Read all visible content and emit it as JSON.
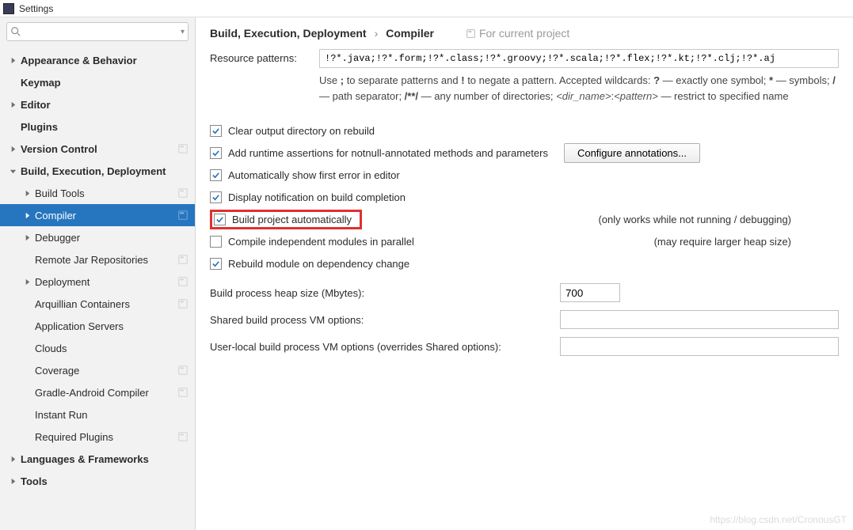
{
  "window": {
    "title": "Settings"
  },
  "search": {
    "placeholder": ""
  },
  "tree": [
    {
      "label": "Appearance & Behavior",
      "level": 0,
      "bold": true,
      "arrow": "right",
      "proj": false
    },
    {
      "label": "Keymap",
      "level": 0,
      "bold": true,
      "arrow": "none",
      "proj": false
    },
    {
      "label": "Editor",
      "level": 0,
      "bold": true,
      "arrow": "right",
      "proj": false
    },
    {
      "label": "Plugins",
      "level": 0,
      "bold": true,
      "arrow": "none",
      "proj": false
    },
    {
      "label": "Version Control",
      "level": 0,
      "bold": true,
      "arrow": "right",
      "proj": true
    },
    {
      "label": "Build, Execution, Deployment",
      "level": 0,
      "bold": true,
      "arrow": "down",
      "proj": false
    },
    {
      "label": "Build Tools",
      "level": 1,
      "bold": false,
      "arrow": "right",
      "proj": true
    },
    {
      "label": "Compiler",
      "level": 1,
      "bold": false,
      "arrow": "right",
      "proj": true,
      "selected": true
    },
    {
      "label": "Debugger",
      "level": 1,
      "bold": false,
      "arrow": "right",
      "proj": false
    },
    {
      "label": "Remote Jar Repositories",
      "level": 1,
      "bold": false,
      "arrow": "none",
      "proj": true
    },
    {
      "label": "Deployment",
      "level": 1,
      "bold": false,
      "arrow": "right",
      "proj": true
    },
    {
      "label": "Arquillian Containers",
      "level": 1,
      "bold": false,
      "arrow": "none",
      "proj": true
    },
    {
      "label": "Application Servers",
      "level": 1,
      "bold": false,
      "arrow": "none",
      "proj": false
    },
    {
      "label": "Clouds",
      "level": 1,
      "bold": false,
      "arrow": "none",
      "proj": false
    },
    {
      "label": "Coverage",
      "level": 1,
      "bold": false,
      "arrow": "none",
      "proj": true
    },
    {
      "label": "Gradle-Android Compiler",
      "level": 1,
      "bold": false,
      "arrow": "none",
      "proj": true
    },
    {
      "label": "Instant Run",
      "level": 1,
      "bold": false,
      "arrow": "none",
      "proj": false
    },
    {
      "label": "Required Plugins",
      "level": 1,
      "bold": false,
      "arrow": "none",
      "proj": true
    },
    {
      "label": "Languages & Frameworks",
      "level": 0,
      "bold": true,
      "arrow": "right",
      "proj": false
    },
    {
      "label": "Tools",
      "level": 0,
      "bold": true,
      "arrow": "right",
      "proj": false
    }
  ],
  "breadcrumb": {
    "a": "Build, Execution, Deployment",
    "b": "Compiler",
    "for_project": "For current project"
  },
  "resource": {
    "label": "Resource patterns:",
    "value": "!?*.java;!?*.form;!?*.class;!?*.groovy;!?*.scala;!?*.flex;!?*.kt;!?*.clj;!?*.aj",
    "help_parts": {
      "p1": "Use ",
      "p2": " to separate patterns and ",
      "p3": " to negate a pattern. Accepted wildcards: ",
      "p4": " — exactly one symbol; ",
      "p5": " — symbols; ",
      "p6": " — path separator; ",
      "p7": " — any number of directories; ",
      "p8": ":",
      "p9": " — restrict to specified name",
      "b1": ";",
      "b2": "!",
      "b3": "?",
      "b4": "*",
      "b5": "/",
      "b6": "/**/",
      "i1": "<dir_name>",
      "i2": "<pattern>"
    }
  },
  "checks": {
    "clear": {
      "label": "Clear output directory on rebuild",
      "checked": true
    },
    "runtime": {
      "label": "Add runtime assertions for notnull-annotated methods and parameters",
      "checked": true,
      "btn": "Configure annotations..."
    },
    "autoerr": {
      "label": "Automatically show first error in editor",
      "checked": true
    },
    "notify": {
      "label": "Display notification on build completion",
      "checked": true
    },
    "autobuild": {
      "label": "Build project automatically",
      "checked": true,
      "note": "(only works while not running / debugging)"
    },
    "parallel": {
      "label": "Compile independent modules in parallel",
      "checked": false,
      "note": "(may require larger heap size)"
    },
    "rebuild": {
      "label": "Rebuild module on dependency change",
      "checked": true
    }
  },
  "fields": {
    "heap": {
      "label": "Build process heap size (Mbytes):",
      "value": "700"
    },
    "shared_vm": {
      "label": "Shared build process VM options:",
      "value": ""
    },
    "user_vm": {
      "label": "User-local build process VM options (overrides Shared options):",
      "value": ""
    }
  },
  "watermark": "https://blog.csdn.net/CronousGT"
}
